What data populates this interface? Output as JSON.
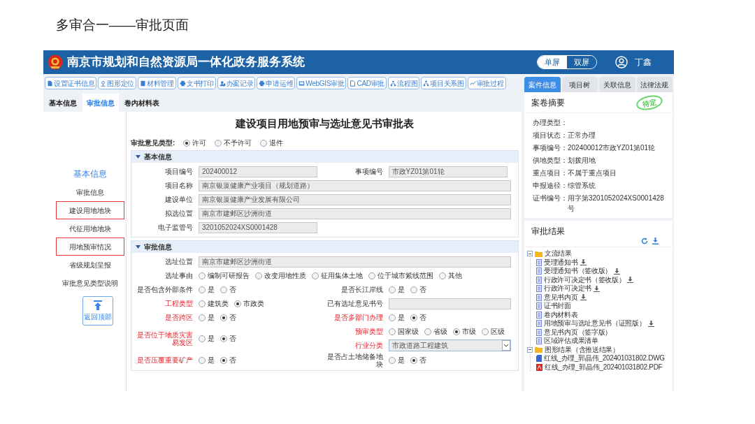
{
  "slide_title": "多审合一——审批页面",
  "header": {
    "title": "南京市规划和自然资源局一体化政务服务系统",
    "screen_modes": [
      {
        "label": "单屏",
        "selected": true
      },
      {
        "label": "双屏",
        "selected": false
      }
    ],
    "user": "丁鑫"
  },
  "toolbar": [
    "设置证书信息",
    "图形定位",
    "材料管理",
    "文书打印",
    "办案记录",
    "申请运维",
    "WebGIS审批",
    "CAD审批",
    "流程图",
    "项目关系图",
    "审批过程"
  ],
  "tabs": [
    {
      "label": "基本信息",
      "selected": false
    },
    {
      "label": "审批信息",
      "selected": true
    },
    {
      "label": "卷内材料表",
      "selected": false
    }
  ],
  "nav": {
    "items": [
      {
        "label": "基本信息",
        "selected": true,
        "highlighted": false
      },
      {
        "label": "审批信息",
        "selected": false,
        "highlighted": false
      },
      {
        "label": "建设用地地块",
        "selected": false,
        "highlighted": true
      },
      {
        "label": "代征用地地块",
        "selected": false,
        "highlighted": false
      },
      {
        "label": "用地预审情况",
        "selected": false,
        "highlighted": true
      },
      {
        "label": "省级规划呈报",
        "selected": false,
        "highlighted": false
      },
      {
        "label": "审批意见类型说明",
        "selected": false,
        "highlighted": false
      }
    ],
    "back_to_top": "返回顶部"
  },
  "form": {
    "title": "建设项目用地预审与选址意见书审批表",
    "opinion_type": {
      "label": "审批意见类型:",
      "options": [
        {
          "label": "许可",
          "selected": true
        },
        {
          "label": "不予许可",
          "selected": false
        },
        {
          "label": "退件",
          "selected": false
        }
      ]
    },
    "sections": [
      {
        "title": "基本信息",
        "expanded": true,
        "rows": [
          {
            "cells": [
              [
                {
                  "kind": "text",
                  "label": "项目编号",
                  "value": "202400012",
                  "required": false,
                  "short": true
                }
              ],
              [
                {
                  "kind": "text",
                  "label": "事项编号",
                  "value": "市政YZ01第01轮",
                  "required": false,
                  "short": true
                }
              ]
            ]
          },
          {
            "cells": [
              [
                {
                  "kind": "text",
                  "label": "项目名称",
                  "value": "南京银厦健康产业项目（规划道路）",
                  "required": false,
                  "short": false
                }
              ]
            ]
          },
          {
            "cells": [
              [
                {
                  "kind": "text",
                  "label": "建设单位",
                  "value": "南京银厦健康产业发展有限公司",
                  "required": false,
                  "short": false
                }
              ]
            ]
          },
          {
            "cells": [
              [
                {
                  "kind": "text",
                  "label": "拟选位置",
                  "value": "南京市建邺区沙洲街道",
                  "required": false,
                  "short": false
                }
              ]
            ]
          },
          {
            "cells": [
              [
                {
                  "kind": "text",
                  "label": "电子监管号",
                  "value": "3201052024XS0001428",
                  "required": false,
                  "short": true
                }
              ]
            ]
          }
        ]
      },
      {
        "title": "审批信息",
        "expanded": true,
        "rows": [
          {
            "cells": [
              [
                {
                  "kind": "text",
                  "label": "选址位置",
                  "value": "南京市建邺区沙洲街道",
                  "required": false,
                  "short": false
                }
              ]
            ]
          },
          {
            "cells": [
              [
                {
                  "kind": "radio",
                  "label": "选址事由",
                  "required": false,
                  "options": [
                    {
                      "label": "编制可研报告",
                      "selected": false
                    },
                    {
                      "label": "改变用地性质",
                      "selected": false
                    },
                    {
                      "label": "征用集体土地",
                      "selected": false
                    },
                    {
                      "label": "位于城市紫线范围",
                      "selected": false
                    },
                    {
                      "label": "其他",
                      "selected": false
                    }
                  ]
                }
              ]
            ]
          },
          {
            "cells": [
              [
                {
                  "kind": "radio",
                  "label": "是否包含外部条件",
                  "required": false,
                  "options": [
                    {
                      "label": "是",
                      "selected": false
                    },
                    {
                      "label": "否",
                      "selected": false
                    }
                  ]
                }
              ],
              [
                {
                  "kind": "radio",
                  "label": "是否长江岸线",
                  "required": false,
                  "options": [
                    {
                      "label": "是",
                      "selected": false
                    },
                    {
                      "label": "否",
                      "selected": false
                    }
                  ]
                }
              ]
            ]
          },
          {
            "cells": [
              [
                {
                  "kind": "radio",
                  "label": "工程类型",
                  "required": true,
                  "options": [
                    {
                      "label": "建筑类",
                      "selected": false
                    },
                    {
                      "label": "市政类",
                      "selected": true
                    }
                  ]
                }
              ],
              [
                {
                  "kind": "text",
                  "label": "已有选址意见书号",
                  "required": false,
                  "short": false
                }
              ]
            ]
          },
          {
            "cells": [
              [
                {
                  "kind": "radio",
                  "label": "是否跨区",
                  "required": true,
                  "options": [
                    {
                      "label": "是",
                      "selected": false
                    },
                    {
                      "label": "否",
                      "selected": true
                    }
                  ]
                }
              ],
              [
                {
                  "kind": "radio",
                  "label": "是否多部门办理",
                  "required": true,
                  "options": [
                    {
                      "label": "是",
                      "selected": false
                    },
                    {
                      "label": "否",
                      "selected": true
                    }
                  ]
                }
              ]
            ]
          },
          {
            "cells": [
              [
                {
                  "kind": "radio",
                  "label": "是否位于地质灾害易发区",
                  "required": true,
                  "options": [
                    {
                      "label": "是",
                      "selected": false
                    },
                    {
                      "label": "否",
                      "selected": true
                    }
                  ]
                }
              ],
              [
                {
                  "kind": "radio",
                  "label": "预审类型",
                  "required": true,
                  "options": [
                    {
                      "label": "国家级",
                      "selected": false
                    },
                    {
                      "label": "省级",
                      "selected": false
                    },
                    {
                      "label": "市级",
                      "selected": true
                    },
                    {
                      "label": "区级",
                      "selected": false
                    }
                  ]
                },
                {
                  "kind": "select",
                  "label": "行业分类",
                  "value": "市政道路工程建筑",
                  "required": true
                }
              ]
            ]
          },
          {
            "cells": [
              [
                {
                  "kind": "radio",
                  "label": "是否压覆重要矿产",
                  "required": true,
                  "options": [
                    {
                      "label": "是",
                      "selected": false
                    },
                    {
                      "label": "否",
                      "selected": true
                    }
                  ]
                }
              ],
              [
                {
                  "kind": "radio",
                  "label": "是否占土地储备地块",
                  "required": false,
                  "options": [
                    {
                      "label": "是",
                      "selected": false
                    },
                    {
                      "label": "否",
                      "selected": true
                    }
                  ]
                }
              ]
            ]
          }
        ]
      }
    ]
  },
  "side_tabs": [
    {
      "label": "案件信息",
      "selected": true
    },
    {
      "label": "项目树",
      "selected": false
    },
    {
      "label": "关联信息",
      "selected": false
    },
    {
      "label": "法律法规",
      "selected": false
    }
  ],
  "summary": {
    "title": "案卷摘要",
    "stamp": "待定",
    "items": [
      {
        "label": "办理类型："
      },
      {
        "label": "项目状态：",
        "value": "正常办理"
      },
      {
        "label": "事项编号：",
        "value": "202400012市政YZ01第01轮"
      },
      {
        "label": "供地类型：",
        "value": "划拨用地"
      },
      {
        "label": "重点项目：",
        "value": "不属于重点项目"
      },
      {
        "label": "申报途径：",
        "value": "综管系统"
      },
      {
        "label": "证书编号：",
        "value": "用字第3201052024XS0001428号"
      }
    ]
  },
  "results": {
    "title": "审批结果",
    "tree": [
      {
        "label": "文流结果",
        "expanded": true,
        "children": [
          {
            "label": "受理通知书",
            "kind": "doc",
            "download": true
          },
          {
            "label": "受理通知书（签收版）",
            "kind": "doc",
            "download": true
          },
          {
            "label": "行政许可决定书（签收版）",
            "kind": "doc",
            "download": true
          },
          {
            "label": "行政许可决定书",
            "kind": "doc",
            "download": true
          },
          {
            "label": "意见书内页",
            "kind": "doc",
            "download": true
          },
          {
            "label": "证书封面",
            "kind": "doc",
            "download": false
          },
          {
            "label": "卷内材料表",
            "kind": "doc",
            "download": false
          },
          {
            "label": "用地预审与选址意见书（证照版）",
            "kind": "doc",
            "download": true
          },
          {
            "label": "意见书内页（签字版）",
            "kind": "doc",
            "download": false
          },
          {
            "label": "区域评估成果清单",
            "kind": "doc",
            "download": false
          }
        ]
      },
      {
        "label": "图形结果（含推送结果）",
        "expanded": true,
        "children": [
          {
            "label": "红线_办理_郭晶伟_202401031802.DWG",
            "kind": "dwg",
            "download": false
          },
          {
            "label": "红线_办理_郭晶伟_202401031802.PDF",
            "kind": "pdf",
            "download": false
          }
        ]
      }
    ]
  }
}
